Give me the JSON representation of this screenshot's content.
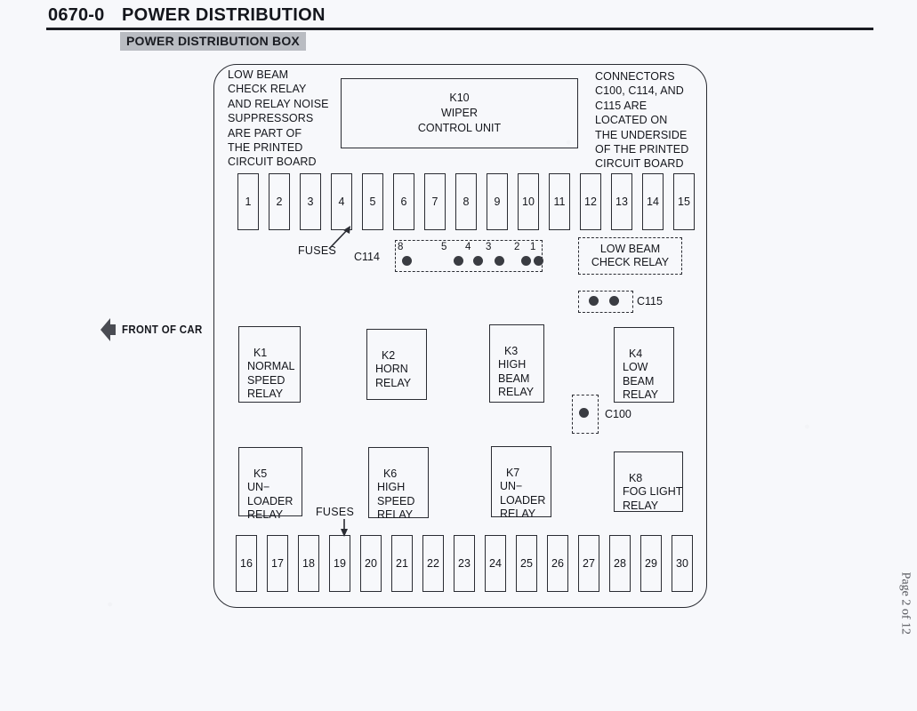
{
  "header": {
    "code": "0670-0",
    "title": "POWER DISTRIBUTION",
    "subtitle": "POWER DISTRIBUTION BOX"
  },
  "footer": {
    "page": "Page 2 of 12"
  },
  "orientation": {
    "label": "FRONT\nOF CAR"
  },
  "notes": {
    "left": "LOW BEAM\nCHECK RELAY\nAND RELAY NOISE\nSUPPRESSORS\nARE PART OF\nTHE PRINTED\nCIRCUIT BOARD",
    "right": "CONNECTORS\nC100, C114, AND\nC115 ARE\nLOCATED ON\nTHE UNDERSIDE\nOF THE PRINTED\nCIRCUIT BOARD"
  },
  "wiper_unit": {
    "id": "K10",
    "line2": "WIPER",
    "line3": "CONTROL UNIT"
  },
  "fuses": {
    "label_top": "FUSES",
    "label_bottom": "FUSES",
    "top_row": [
      "1",
      "2",
      "3",
      "4",
      "5",
      "6",
      "7",
      "8",
      "9",
      "10",
      "11",
      "12",
      "13",
      "14",
      "15"
    ],
    "bottom_row": [
      "16",
      "17",
      "18",
      "19",
      "20",
      "21",
      "22",
      "23",
      "24",
      "25",
      "26",
      "27",
      "28",
      "29",
      "30"
    ]
  },
  "connectors": {
    "c114": {
      "label": "C114",
      "pins": [
        "8",
        "5",
        "4",
        "3",
        "2",
        "1"
      ]
    },
    "c115": {
      "label": "C115",
      "pin_count": 2
    },
    "c100": {
      "label": "C100",
      "pin_count": 1
    }
  },
  "low_beam_check_relay": {
    "line1": "LOW BEAM",
    "line2": "CHECK RELAY"
  },
  "relays": [
    {
      "id": "K1",
      "name": "NORMAL\nSPEED\nRELAY"
    },
    {
      "id": "K2",
      "name": "HORN\nRELAY"
    },
    {
      "id": "K3",
      "name": "HIGH\nBEAM\nRELAY"
    },
    {
      "id": "K4",
      "name": "LOW\nBEAM\nRELAY"
    },
    {
      "id": "K5",
      "name": "UN−\nLOADER\nRELAY"
    },
    {
      "id": "K6",
      "name": "HIGH\nSPEED\nRELAY"
    },
    {
      "id": "K7",
      "name": "UN−\nLOADER\nRELAY"
    },
    {
      "id": "K8",
      "name": "FOG LIGHT\nRELAY"
    }
  ],
  "colors": {
    "ink": "#2a2c33",
    "paper": "#f7f8fb",
    "band": "#b9bcc2"
  }
}
